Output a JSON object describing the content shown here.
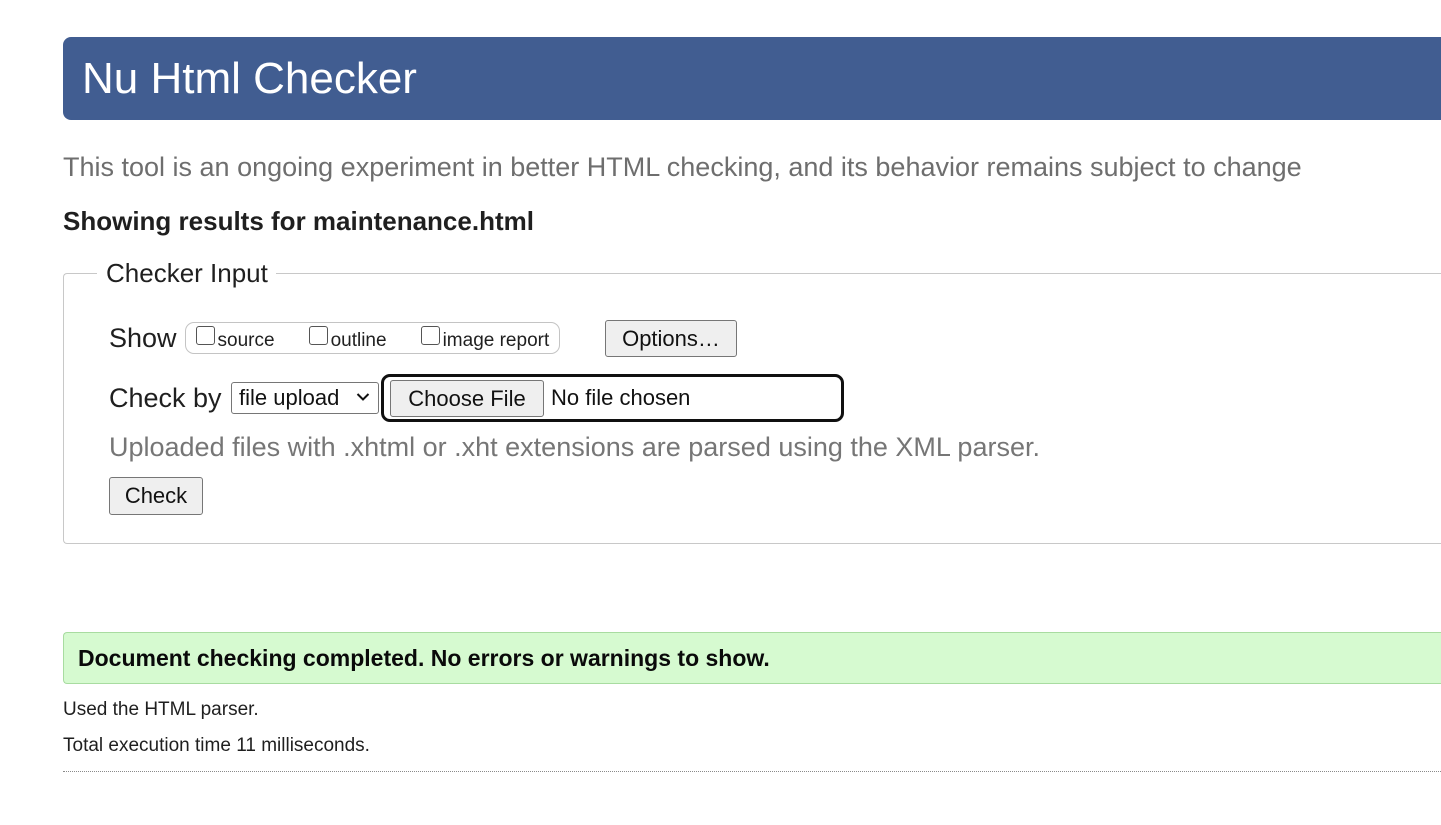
{
  "header": {
    "title": "Nu Html Checker"
  },
  "intro": "This tool is an ongoing experiment in better HTML checking, and its behavior remains subject to change",
  "results_heading": "Showing results for maintenance.html",
  "checker_input": {
    "legend": "Checker Input",
    "show_label": "Show",
    "show_options": [
      {
        "label": "source",
        "checked": false
      },
      {
        "label": "outline",
        "checked": false
      },
      {
        "label": "image report",
        "checked": false
      }
    ],
    "options_button": "Options…",
    "check_by_label": "Check by",
    "check_by_selected": "file upload",
    "choose_file_button": "Choose File",
    "file_status": "No file chosen",
    "hint": "Uploaded files with .xhtml or .xht extensions are parsed using the XML parser.",
    "check_button": "Check"
  },
  "result": {
    "message": "Document checking completed. No errors or warnings to show.",
    "parser_info": "Used the HTML parser.",
    "execution_time": "Total execution time 11 milliseconds."
  },
  "colors": {
    "header_bg": "#415d91",
    "success_bg": "#d6fad0"
  },
  "icons": {
    "select_arrow": "chevron-down-icon"
  }
}
